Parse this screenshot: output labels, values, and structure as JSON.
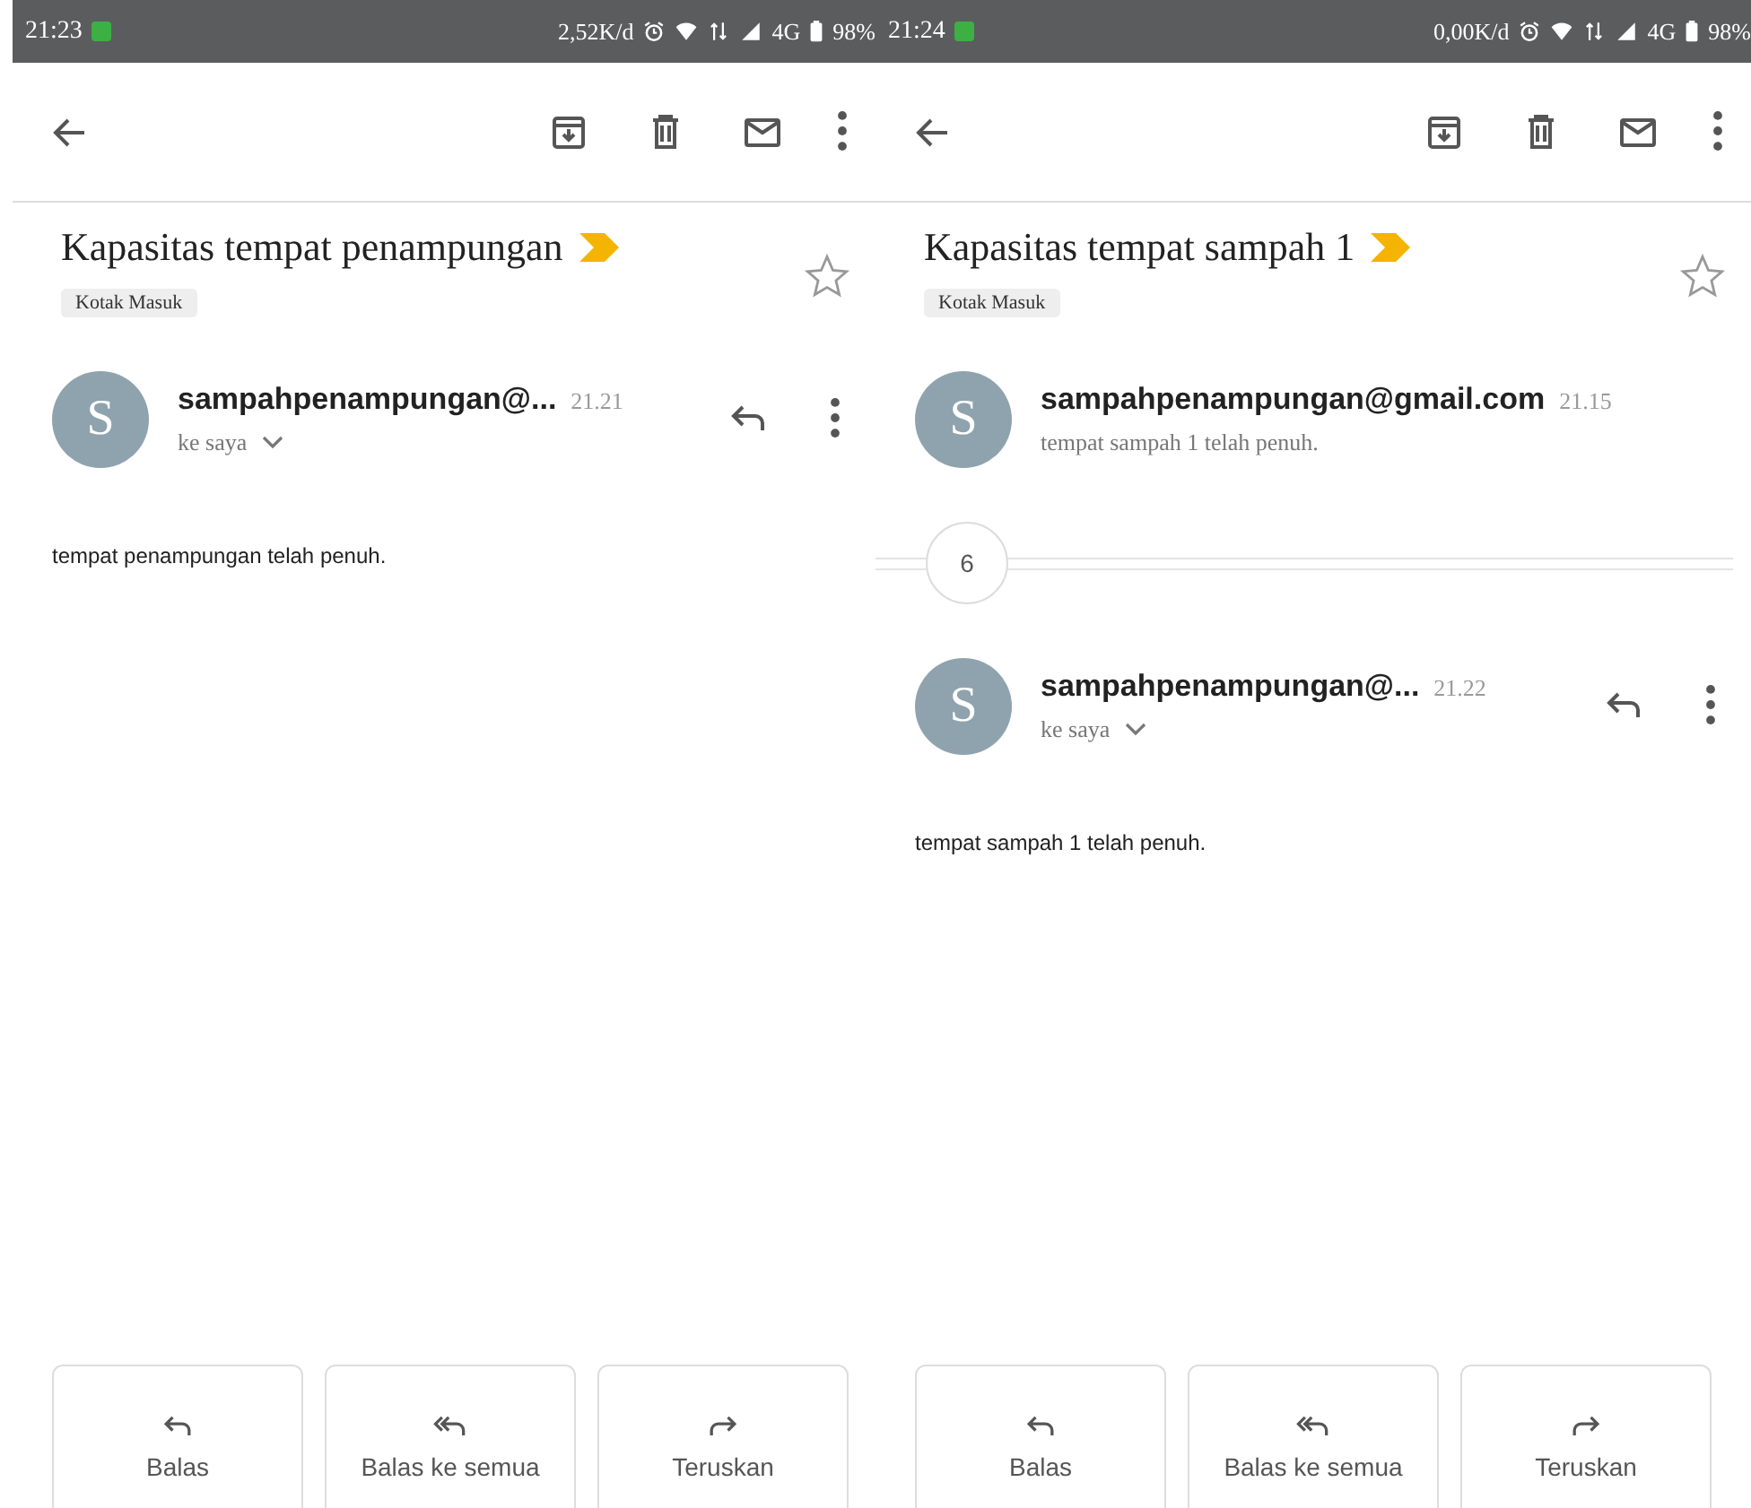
{
  "screens": [
    {
      "status_bar": {
        "time": "21:23",
        "speed": "2,52K/d",
        "network": "4G",
        "battery": "98%"
      },
      "subject": "Kapasitas tempat penampungan",
      "label": "Kotak Masuk",
      "starred": false,
      "messages": [
        {
          "kind": "expanded",
          "avatar": "S",
          "sender": "sampahpenampungan@...",
          "time": "21.21",
          "recipient": "ke saya",
          "body": "tempat penampungan telah penuh."
        }
      ],
      "actions": [
        "Balas",
        "Balas ke semua",
        "Teruskan"
      ]
    },
    {
      "status_bar": {
        "time": "21:24",
        "speed": "0,00K/d",
        "network": "4G",
        "battery": "98%"
      },
      "subject": "Kapasitas tempat sampah 1",
      "label": "Kotak Masuk",
      "starred": false,
      "messages": [
        {
          "kind": "collapsed",
          "avatar": "S",
          "sender": "sampahpenampungan@gmail.com",
          "time": "21.15",
          "snippet": "tempat sampah 1 telah penuh."
        },
        {
          "kind": "count",
          "count": "6"
        },
        {
          "kind": "expanded",
          "avatar": "S",
          "sender": "sampahpenampungan@...",
          "time": "21.22",
          "recipient": "ke saya",
          "body": "tempat sampah 1 telah penuh."
        }
      ],
      "actions": [
        "Balas",
        "Balas ke semua",
        "Teruskan"
      ]
    }
  ]
}
